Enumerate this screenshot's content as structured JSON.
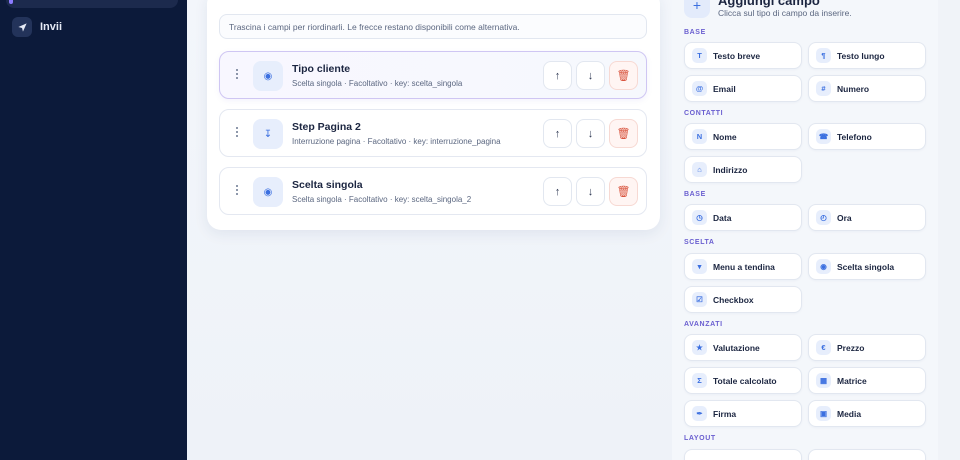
{
  "sidebar": {
    "items": [
      {
        "label": "Invii",
        "icon": "send-icon"
      }
    ]
  },
  "builder": {
    "hint": "Trascina i campi per riordinarli. Le frecce restano disponibili come alternativa.",
    "fields": [
      {
        "title": "Tipo cliente",
        "meta": "Scelta singola · Facoltativo · key: scelta_singola",
        "icon": "radio-icon",
        "glyph": "◉",
        "selected": true
      },
      {
        "title": "Step Pagina 2",
        "meta": "Interruzione pagina · Facoltativo · key: interruzione_pagina",
        "icon": "page-break-icon",
        "glyph": "↧",
        "selected": false
      },
      {
        "title": "Scelta singola",
        "meta": "Scelta singola · Facoltativo · key: scelta_singola_2",
        "icon": "radio-icon",
        "glyph": "◉",
        "selected": false
      }
    ],
    "buttons": {
      "up": "↑",
      "down": "↓",
      "delete": "🗑"
    }
  },
  "panel": {
    "title": "Aggiungi campo",
    "subtitle": "Clicca sul tipo di campo da inserire.",
    "add_glyph": "+",
    "sections": [
      {
        "label": "BASE",
        "items": [
          {
            "label": "Testo breve",
            "glyph": "T",
            "icon": "text-icon"
          },
          {
            "label": "Testo lungo",
            "glyph": "¶",
            "icon": "paragraph-icon"
          },
          {
            "label": "Email",
            "glyph": "@",
            "icon": "email-icon"
          },
          {
            "label": "Numero",
            "glyph": "#",
            "icon": "number-icon"
          }
        ]
      },
      {
        "label": "CONTATTI",
        "items": [
          {
            "label": "Nome",
            "glyph": "N",
            "icon": "name-icon"
          },
          {
            "label": "Telefono",
            "glyph": "☎",
            "icon": "phone-icon"
          },
          {
            "label": "Indirizzo",
            "glyph": "⌂",
            "icon": "home-icon"
          }
        ]
      },
      {
        "label": "BASE",
        "items": [
          {
            "label": "Data",
            "glyph": "◷",
            "icon": "calendar-icon"
          },
          {
            "label": "Ora",
            "glyph": "◴",
            "icon": "clock-icon"
          }
        ]
      },
      {
        "label": "SCELTA",
        "items": [
          {
            "label": "Menu a tendina",
            "glyph": "▾",
            "icon": "dropdown-icon"
          },
          {
            "label": "Scelta singola",
            "glyph": "◉",
            "icon": "radio-icon"
          },
          {
            "label": "Checkbox",
            "glyph": "☑",
            "icon": "checkbox-icon"
          }
        ]
      },
      {
        "label": "AVANZATI",
        "items": [
          {
            "label": "Valutazione",
            "glyph": "★",
            "icon": "star-icon"
          },
          {
            "label": "Prezzo",
            "glyph": "€",
            "icon": "euro-icon"
          },
          {
            "label": "Totale calcolato",
            "glyph": "Σ",
            "icon": "sum-icon"
          },
          {
            "label": "Matrice",
            "glyph": "▦",
            "icon": "grid-icon"
          },
          {
            "label": "Firma",
            "glyph": "✒",
            "icon": "signature-icon"
          },
          {
            "label": "Media",
            "glyph": "▣",
            "icon": "media-icon"
          }
        ]
      },
      {
        "label": "LAYOUT",
        "items": []
      }
    ]
  }
}
